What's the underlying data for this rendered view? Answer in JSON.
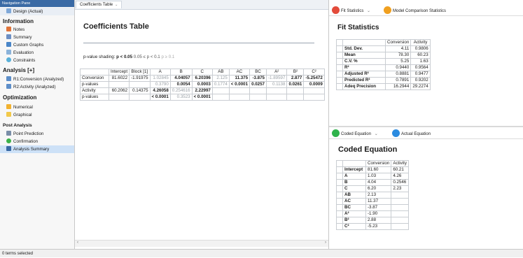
{
  "nav": {
    "header": "Navigation Pane",
    "design": "Design (Actual)",
    "information_label": "Information",
    "information_items": [
      "Notes",
      "Summary",
      "Custom Graphs",
      "Evaluation",
      "Constraints"
    ],
    "analysis_label": "Analysis [+]",
    "analysis_items": [
      "R1:Conversion (Analyzed)",
      "R2:Activity (Analyzed)"
    ],
    "optimization_label": "Optimization",
    "optimization_items": [
      "Numerical",
      "Graphical"
    ],
    "post_label": "Post Analysis",
    "post_items": [
      "Point Prediction",
      "Confirmation",
      "Analysis Summary"
    ]
  },
  "center": {
    "tab_label": "Coefficients Table",
    "title": "Coefficients Table",
    "shading": {
      "prefix": "p-value shading:",
      "p": "p",
      "lt1": "< 0.05",
      "mid": "0.05 ≤ p < 0.1",
      "faint": "p ≥ 0.1"
    },
    "table": {
      "headers": [
        "",
        "Intercept",
        "Block [1]",
        "A",
        "B",
        "C",
        "AB",
        "AC",
        "BC",
        "A²",
        "B²",
        "C²"
      ],
      "rows": [
        {
          "cells": [
            "Conversion",
            "81.6022",
            "-1.91975",
            "1.02845",
            "4.04057",
            "6.20396",
            "2.125",
            "11.375",
            "-3.875",
            "-1.89597",
            "2.877",
            "-5.25472"
          ]
        },
        {
          "cells": [
            "p-values",
            "",
            "",
            "0.3790",
            "0.0054",
            "0.0003",
            "0.1774",
            "< 0.0001",
            "0.0257",
            "0.1138",
            "0.0261",
            "0.0009"
          ]
        },
        {
          "cells": [
            "Activity",
            "60.2062",
            "0.14375",
            "4.26058",
            "0.254616",
            "2.22997",
            "",
            "",
            "",
            "",
            "",
            ""
          ]
        },
        {
          "cells": [
            "p-values",
            "",
            "",
            "< 0.0001",
            "0.3523",
            "< 0.0001",
            "",
            "",
            "",
            "",
            "",
            ""
          ]
        }
      ]
    }
  },
  "fit": {
    "tab1": "Fit Statistics",
    "tab2": "Model Comparison Statistics",
    "title": "Fit Statistics",
    "headers": [
      "",
      "",
      "Conversion",
      "Activity"
    ],
    "rows": [
      [
        "Std. Dev.",
        "4.11",
        "0.9806"
      ],
      [
        "Mean",
        "78.30",
        "60.23"
      ],
      [
        "C.V. %",
        "5.25",
        "1.63"
      ],
      [
        "R²",
        "0.9440",
        "0.9564"
      ],
      [
        "Adjusted R²",
        "0.8881",
        "0.9477"
      ],
      [
        "Predicted R²",
        "0.7891",
        "0.9202"
      ],
      [
        "Adeq Precision",
        "16.2944",
        "29.2274"
      ]
    ]
  },
  "coded": {
    "tab1": "Coded Equation",
    "tab2": "Actual Equation",
    "title": "Coded Equation",
    "headers": [
      "",
      "",
      "Conversion",
      "Activity"
    ],
    "rows": [
      [
        "Intercept",
        "81.60",
        "60.21"
      ],
      [
        "A",
        "1.03",
        "4.26"
      ],
      [
        "B",
        "4.04",
        "0.2546"
      ],
      [
        "C",
        "6.20",
        "2.23"
      ],
      [
        "AB",
        "2.13",
        ""
      ],
      [
        "AC",
        "11.37",
        ""
      ],
      [
        "BC",
        "-3.87",
        ""
      ],
      [
        "A²",
        "-1.90",
        ""
      ],
      [
        "B²",
        "2.88",
        ""
      ],
      [
        "C²",
        "-5.23",
        ""
      ]
    ]
  },
  "status": "0 terms selected",
  "colors": {
    "accent": "#3a6aa5",
    "selected": "#cde1f7",
    "fit_icon": "#e34b3b",
    "model_icon": "#f0a020",
    "coded_icon": "#2eb34b",
    "actual_icon": "#2a8be0"
  }
}
